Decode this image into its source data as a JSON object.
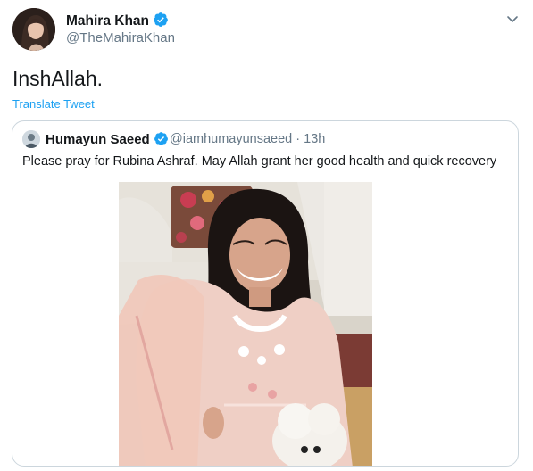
{
  "tweet": {
    "author": {
      "name": "Mahira Khan",
      "handle": "@TheMahiraKhan",
      "verified": true
    },
    "text": "InshAllah.",
    "translate_label": "Translate Tweet",
    "menu_icon": "chevron-down-icon"
  },
  "quoted_tweet": {
    "author": {
      "name": "Humayun Saeed",
      "handle": "@iamhumayunsaeed",
      "verified": true
    },
    "separator": "·",
    "time": "13h",
    "text": "Please pray for Rubina Ashraf. May Allah grant her good health and quick recovery",
    "media": "photo"
  },
  "colors": {
    "primary_text": "#14171a",
    "secondary_text": "#657786",
    "link": "#1da1f2",
    "verified_badge": "#1da1f2",
    "border": "#ccd6dd"
  }
}
